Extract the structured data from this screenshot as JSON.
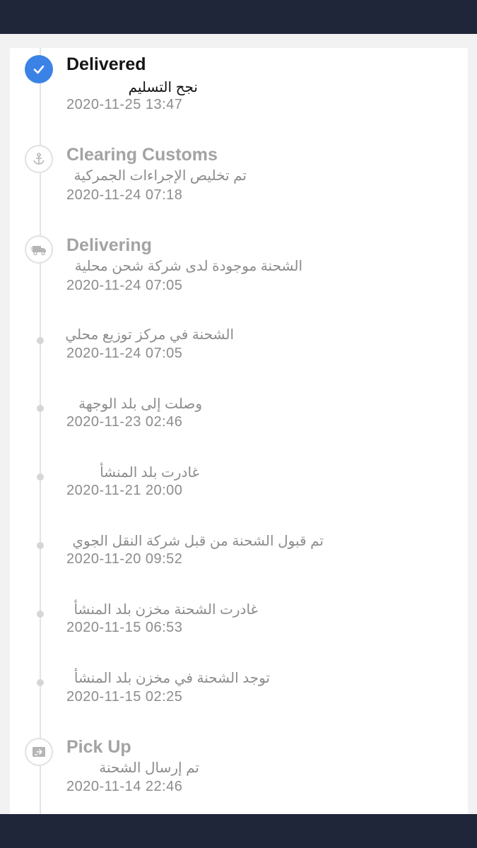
{
  "events": [
    {
      "title": "Delivered",
      "description": "نجح التسليم",
      "time": "2020-11-25 13:47",
      "icon": "check-icon",
      "state": "current"
    },
    {
      "title": "Clearing Customs",
      "description": "تم تخليص الإجراءات الجمركية",
      "time": "2020-11-24 07:18",
      "icon": "anchor-icon",
      "state": "past"
    },
    {
      "title": "Delivering",
      "description": "الشحنة موجودة لدى شركة شحن محلية",
      "time": "2020-11-24 07:05",
      "icon": "truck-icon",
      "state": "past"
    },
    {
      "description": "الشحنة في مركز توزيع محلي",
      "time": "2020-11-24 07:05",
      "state": "past"
    },
    {
      "description": "وصلت إلى بلد الوجهة",
      "time": "2020-11-23 02:46",
      "state": "past"
    },
    {
      "description": "غادرت بلد المنشأ",
      "time": "2020-11-21 20:00",
      "state": "past"
    },
    {
      "description": "تم قبول الشحنة من قبل شركة النقل الجوي",
      "time": "2020-11-20 09:52",
      "state": "past"
    },
    {
      "description": "غادرت الشحنة مخزن بلد المنشأ",
      "time": "2020-11-15 06:53",
      "state": "past"
    },
    {
      "description": "توجد الشحنة في مخزن بلد المنشأ",
      "time": "2020-11-15 02:25",
      "state": "past"
    },
    {
      "title": "Pick Up",
      "description": "تم إرسال الشحنة",
      "time": "2020-11-14 22:46",
      "icon": "package-icon",
      "state": "past"
    }
  ],
  "colors": {
    "accent": "#3b82e6",
    "bar": "#1f2639"
  }
}
